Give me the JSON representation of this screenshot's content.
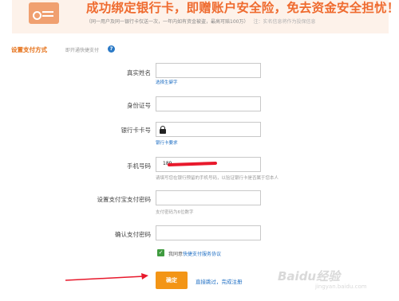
{
  "banner": {
    "title": "成功绑定银行卡，即赠账户安全险，免去资金安全担忧！",
    "subtitle": "（同一用户及同一银行卡仅送一次，一年内如有资金被盗，最高可赔100万）",
    "note": "注：实名信息将作为投保信息"
  },
  "section": {
    "title": "设置支付方式",
    "hint": "即开通快捷支付",
    "help_glyph": "?"
  },
  "form": {
    "real_name": {
      "label": "真实姓名",
      "value": "",
      "link": "选择生僻字"
    },
    "id_number": {
      "label": "身份证号",
      "value": ""
    },
    "card_number": {
      "label": "银行卡卡号",
      "value": "",
      "link": "银行卡要求"
    },
    "phone": {
      "label": "手机号码",
      "value": "189",
      "hint": "请填写您在银行预留的手机号码，以验证银行卡是否属于您本人"
    },
    "pay_password": {
      "label": "设置支付宝支付密码",
      "value": "",
      "hint": "支付密码为6位数字"
    },
    "confirm_password": {
      "label": "确认支付密码",
      "value": ""
    },
    "agreement": {
      "checked": true,
      "check_glyph": "✓",
      "prefix": "我同意",
      "link": "快捷支付服务协议"
    },
    "submit_label": "确定",
    "skip_link": "直接跳过，完成注册"
  },
  "watermark": {
    "text": "Baidu经验",
    "sub": "jingyan.baidu.com"
  },
  "colors": {
    "accent": "#ef6b2f",
    "button": "#f39516",
    "link": "#1f6fc4",
    "annotation_arrow": "#e8192c"
  }
}
